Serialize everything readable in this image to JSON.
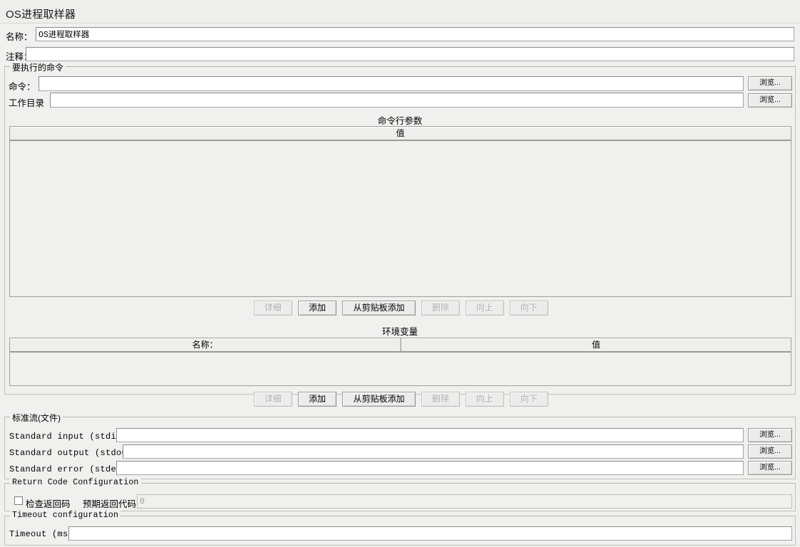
{
  "window": {
    "title": "OS进程取样器"
  },
  "header": {
    "name_label": "名称：",
    "name_value": "OS进程取样器",
    "comment_label": "注释：",
    "comment_value": ""
  },
  "command_panel": {
    "title": "要执行的命令",
    "command_label": "命令：",
    "command_value": "",
    "command_browse": "浏览...",
    "workdir_label": "工作目录",
    "workdir_value": "",
    "workdir_browse": "浏览..."
  },
  "arguments": {
    "caption": "命令行参数",
    "columns": [
      "值"
    ],
    "rows": [],
    "buttons": [
      {
        "label": "详细",
        "enabled": false
      },
      {
        "label": "添加",
        "enabled": true
      },
      {
        "label": "从剪贴板添加",
        "enabled": true
      },
      {
        "label": "删除",
        "enabled": false
      },
      {
        "label": "向上",
        "enabled": false
      },
      {
        "label": "向下",
        "enabled": false
      }
    ]
  },
  "environment": {
    "caption": "环境变量",
    "columns": [
      "名称：",
      "值"
    ],
    "rows": [],
    "buttons": [
      {
        "label": "详细",
        "enabled": false
      },
      {
        "label": "添加",
        "enabled": true
      },
      {
        "label": "从剪贴板添加",
        "enabled": true
      },
      {
        "label": "删除",
        "enabled": false
      },
      {
        "label": "向上",
        "enabled": false
      },
      {
        "label": "向下",
        "enabled": false
      }
    ]
  },
  "streams": {
    "title": "标准流(文件)",
    "stdin_label": "Standard input (stdin):",
    "stdin_value": "",
    "stdin_browse": "浏览...",
    "stdout_label": "Standard output (stdout):",
    "stdout_value": "",
    "stdout_browse": "浏览...",
    "stderr_label": "Standard error (stderr):",
    "stderr_value": "",
    "stderr_browse": "浏览..."
  },
  "return_code": {
    "title": "Return Code Configuration",
    "check_label": "检查返回码",
    "checked": false,
    "expected_label": "预期返回代码：",
    "expected_value": "0",
    "expected_enabled": false
  },
  "timeout": {
    "title": "Timeout configuration",
    "label": "Timeout (ms)",
    "value": ""
  }
}
